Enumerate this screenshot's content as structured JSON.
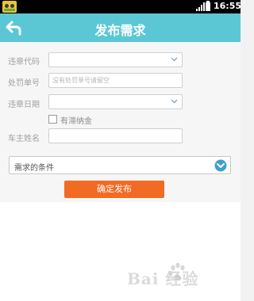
{
  "status_bar": {
    "time": "16:55"
  },
  "title_bar": {
    "title": "发布需求"
  },
  "form": {
    "violation_code": {
      "label": "违章代码",
      "value": ""
    },
    "penalty_number": {
      "label": "处罚单号",
      "placeholder": "没有处罚单号请留空"
    },
    "violation_date": {
      "label": "违章日期",
      "value": ""
    },
    "late_fee": {
      "label": "有滞纳金",
      "checked": false
    },
    "owner_name": {
      "label": "车主姓名",
      "value": ""
    }
  },
  "conditions": {
    "label": "需求的条件"
  },
  "submit": {
    "label": "确定发布"
  },
  "watermark": {
    "text": "Bai  经验"
  },
  "colors": {
    "title_bar": "#5bc7d4",
    "submit_button": "#f26b24",
    "expand_icon": "#3da0cf"
  }
}
